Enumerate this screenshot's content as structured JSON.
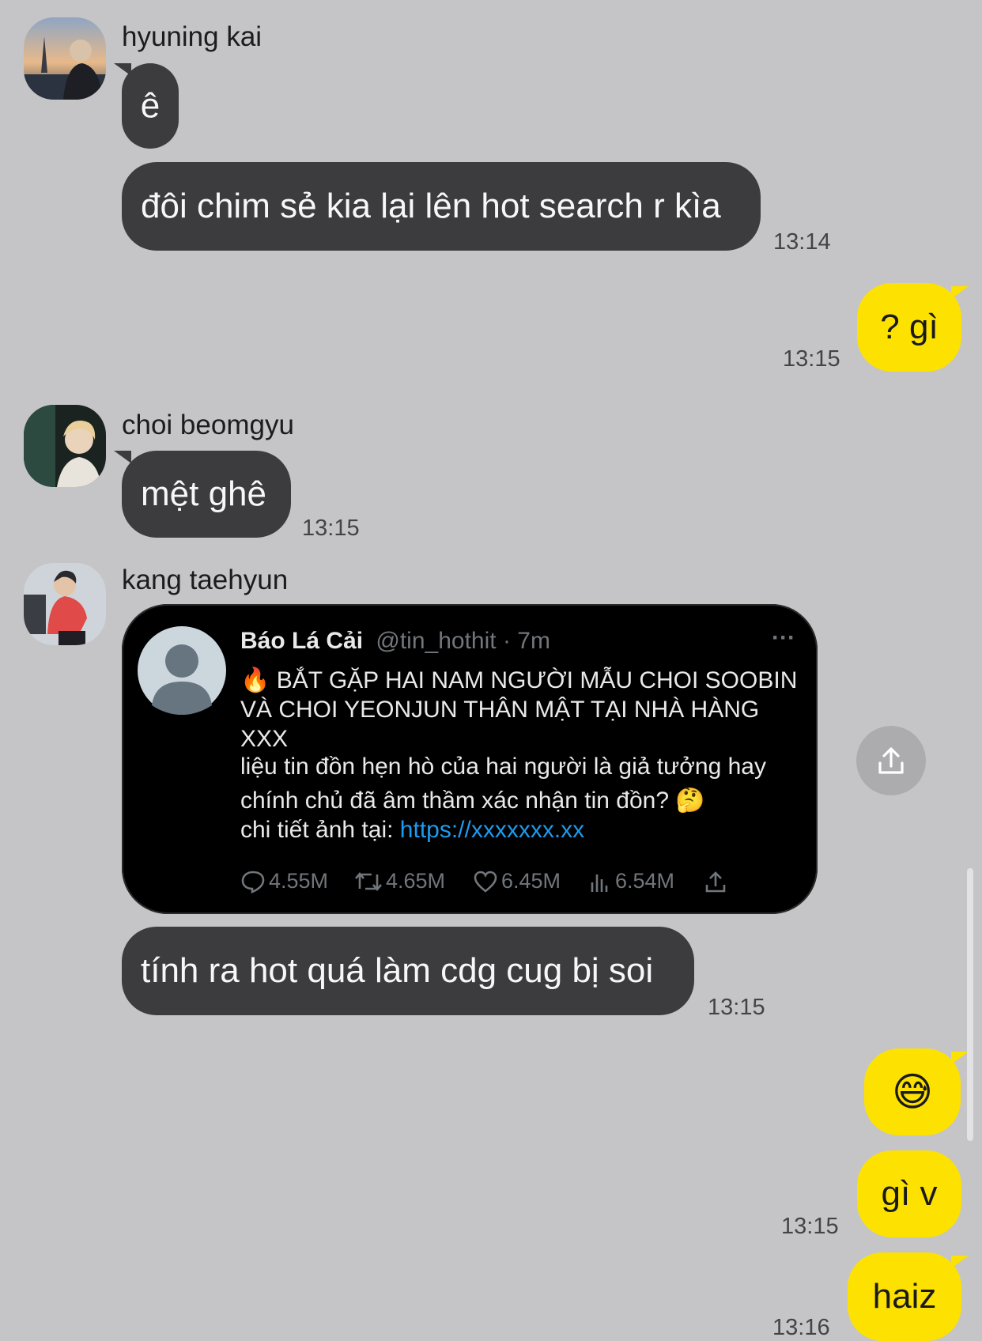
{
  "messages": {
    "m1": {
      "sender": "hyuning kai",
      "text": "ê"
    },
    "m2": {
      "text": "đôi chim sẻ kia lại lên hot search r kìa",
      "time": "13:14"
    },
    "m3": {
      "text": "? gì",
      "time": "13:15"
    },
    "m4": {
      "sender": "choi beomgyu",
      "text": "mệt ghê",
      "time": "13:15"
    },
    "m5": {
      "sender": "kang taehyun"
    },
    "m6": {
      "text": "tính ra hot quá làm cdg cug bị soi",
      "time": "13:15"
    },
    "m7": {
      "emoji": "😅"
    },
    "m8": {
      "text": "gì v",
      "time": "13:15"
    },
    "m9": {
      "text": "haiz",
      "time": "13:16"
    }
  },
  "tweet": {
    "author": "Báo Lá Cải",
    "handle": "@tin_hothit · 7m",
    "more": "···",
    "line1": "🔥 BẮT GẶP HAI NAM NGƯỜI MẪU CHOI SOOBIN",
    "line2": "VÀ CHOI YEONJUN THÂN MẬT TẠI NHÀ HÀNG",
    "line3": "XXX",
    "line4": "liệu tin đồn hẹn hò của hai người là giả tưởng hay",
    "line5": "chính chủ đã âm thầm xác nhận tin đồn? 🤔",
    "link_prefix": "chi tiết ảnh tại: ",
    "link": "https://xxxxxxx.xx",
    "replies": "4.55M",
    "retweets": "4.65M",
    "likes": "6.45M",
    "views": "6.54M"
  },
  "icons": {
    "share": "share-icon",
    "reply": "reply-icon",
    "retweet": "retweet-icon",
    "like": "heart-icon",
    "views": "views-icon"
  }
}
